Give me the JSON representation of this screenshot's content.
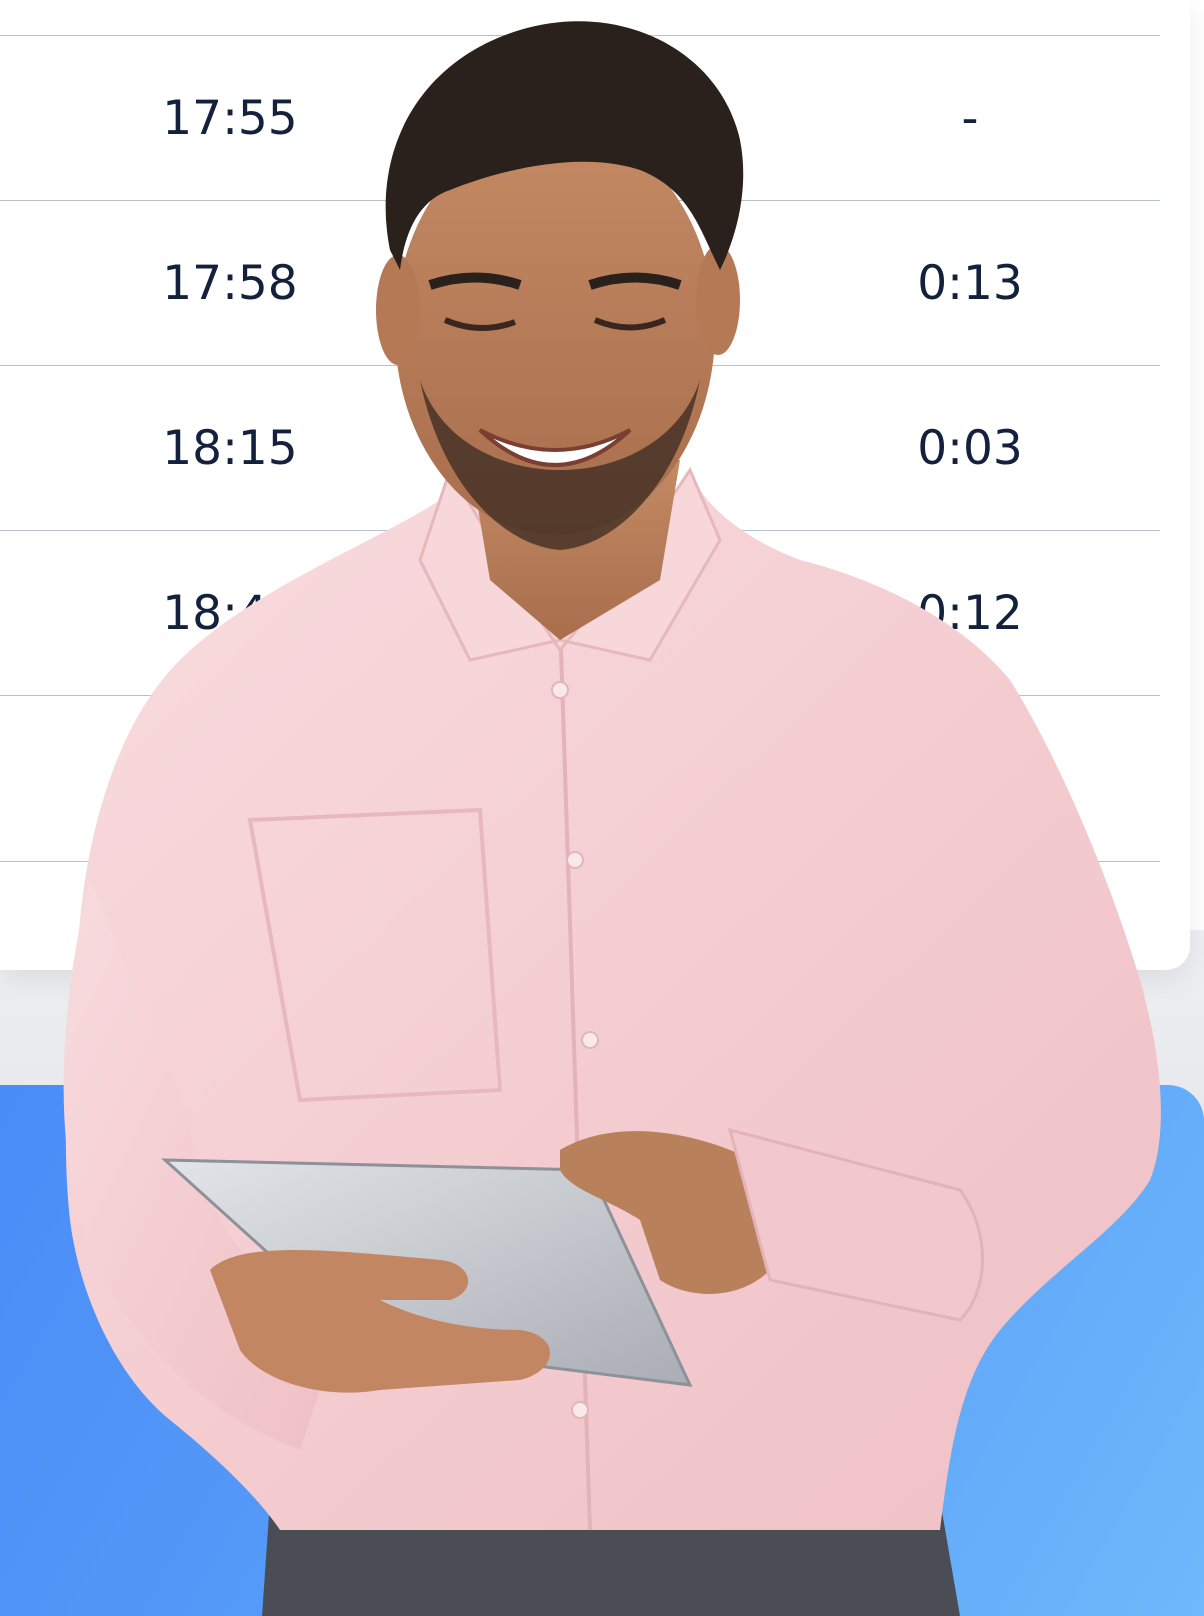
{
  "table": {
    "rows": [
      {
        "time": "17:55",
        "duration": "-"
      },
      {
        "time": "17:58",
        "duration": "0:13"
      },
      {
        "time": "18:15",
        "duration": "0:03"
      },
      {
        "time": "18:42",
        "duration": "0:12"
      },
      {
        "time": "",
        "duration": ""
      }
    ]
  },
  "colors": {
    "text": "#14213d",
    "divider": "#b8c0cc",
    "blue_start": "#4a8cf7",
    "blue_end": "#6fb8fb",
    "shirt": "#f6d3d6"
  },
  "image": {
    "subject": "smiling man in pink shirt holding tablet"
  }
}
